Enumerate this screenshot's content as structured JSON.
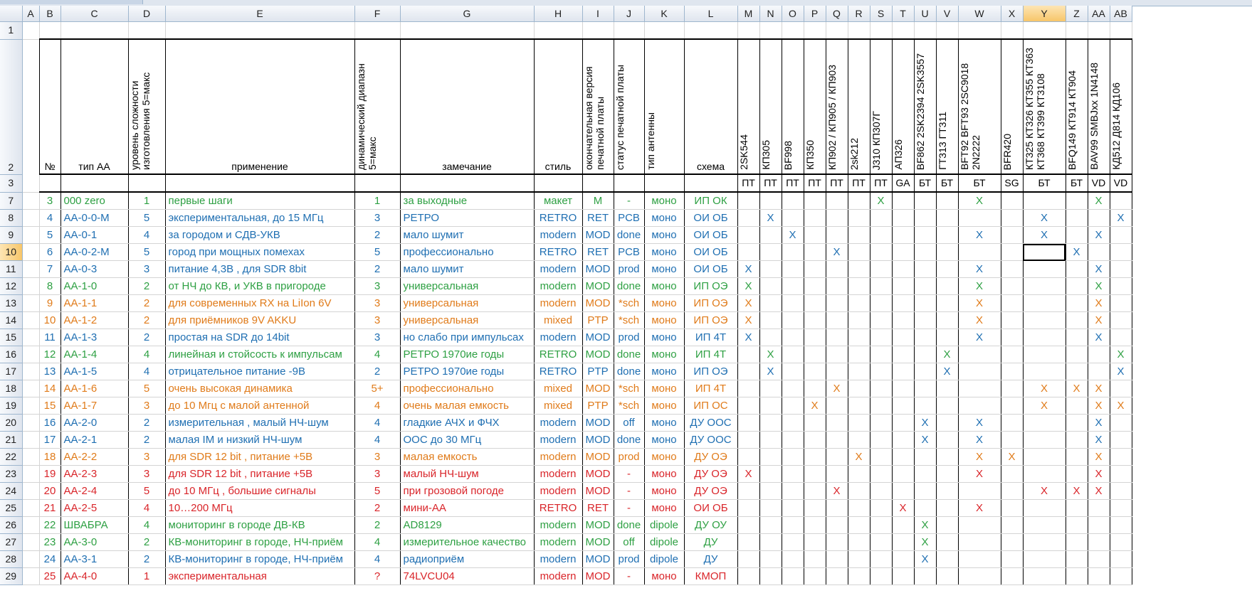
{
  "columns": [
    {
      "letter": "A",
      "w": 24
    },
    {
      "letter": "B",
      "w": 30
    },
    {
      "letter": "C",
      "w": 95
    },
    {
      "letter": "D",
      "w": 52
    },
    {
      "letter": "E",
      "w": 266
    },
    {
      "letter": "F",
      "w": 64
    },
    {
      "letter": "G",
      "w": 188
    },
    {
      "letter": "H",
      "w": 68
    },
    {
      "letter": "I",
      "w": 44
    },
    {
      "letter": "J",
      "w": 43
    },
    {
      "letter": "K",
      "w": 56
    },
    {
      "letter": "L",
      "w": 75
    },
    {
      "letter": "M",
      "w": 31
    },
    {
      "letter": "N",
      "w": 31
    },
    {
      "letter": "O",
      "w": 31
    },
    {
      "letter": "P",
      "w": 31
    },
    {
      "letter": "Q",
      "w": 31
    },
    {
      "letter": "R",
      "w": 31
    },
    {
      "letter": "S",
      "w": 31
    },
    {
      "letter": "T",
      "w": 31
    },
    {
      "letter": "U",
      "w": 31
    },
    {
      "letter": "V",
      "w": 31
    },
    {
      "letter": "W",
      "w": 60
    },
    {
      "letter": "X",
      "w": 31
    },
    {
      "letter": "Y",
      "w": 60
    },
    {
      "letter": "Z",
      "w": 31
    },
    {
      "letter": "AA",
      "w": 31
    },
    {
      "letter": "AB",
      "w": 31
    }
  ],
  "selected": {
    "col": "Y",
    "row": "10"
  },
  "row1": {
    "num": "1"
  },
  "row2": {
    "num": "2",
    "cells": [
      "",
      "№",
      "тип АА",
      "уровень сложности изготовления 5=макс",
      "применение",
      "динамический диапазн 5=макс",
      "замечание",
      "стиль",
      "окончательная версия печатной платы",
      "статус печатной платы",
      "тип антенны",
      "схема",
      "2SK544",
      "КП305",
      "BF998",
      "КП350",
      "КП902 / КП905 / КП903",
      "2sk212",
      "J310 КП307Г",
      "АП326",
      "BF862 2SK2394 2SK3557",
      "ГТ313 ГТ311",
      "BFT92 BFT93 2SC9018 2N2222",
      "BFR420",
      "КТ325 КТ326 КТ355 КТ363 КТ368 КТ399 КТ3108",
      "BFQ149 КТ914 КТ904",
      "BAV99 SMBJxx 1N4148",
      "КД512 Д814 КД106"
    ]
  },
  "row3": {
    "num": "3",
    "cells": [
      "",
      "",
      "",
      "",
      "",
      "",
      "",
      "",
      "",
      "",
      "",
      "",
      "ПТ",
      "ПТ",
      "ПТ",
      "ПТ",
      "ПТ",
      "ПТ",
      "ПТ",
      "GA",
      "БТ",
      "БТ",
      "БТ",
      "SG",
      "БТ",
      "БТ",
      "VD",
      "VD"
    ]
  },
  "rows": [
    {
      "num": "7",
      "color": "green",
      "cells": [
        "",
        "3",
        "000 zero",
        "1",
        "первые шаги",
        "1",
        "за выходные",
        "макет",
        "М",
        "-",
        "моно",
        "ИП ОК",
        "",
        "",
        "",
        "",
        "",
        "",
        "X",
        "",
        "",
        "",
        "X",
        "",
        "",
        "",
        "X",
        ""
      ]
    },
    {
      "num": "8",
      "color": "blue",
      "cells": [
        "",
        "4",
        "АА-0-0-М",
        "5",
        "экспериментальная, до 15 МГц",
        "3",
        "РЕТРО",
        "RETRO",
        "RET",
        "PCB",
        "моно",
        "ОИ ОБ",
        "",
        "X",
        "",
        "",
        "",
        "",
        "",
        "",
        "",
        "",
        "",
        "",
        "X",
        "",
        "",
        "X"
      ]
    },
    {
      "num": "9",
      "color": "blue",
      "cells": [
        "",
        "5",
        "АА-0-1",
        "4",
        "за городом и СДВ-УКВ",
        "2",
        "мало шумит",
        "modern",
        "MOD",
        "done",
        "моно",
        "ОИ ОБ",
        "",
        "",
        "X",
        "",
        "",
        "",
        "",
        "",
        "",
        "",
        "X",
        "",
        "X",
        "",
        "X",
        ""
      ]
    },
    {
      "num": "10",
      "color": "blue",
      "cells": [
        "",
        "6",
        "АА-0-2-М",
        "5",
        "город при мощных помехах",
        "5",
        "профессионально",
        "RETRO",
        "RET",
        "PCB",
        "моно",
        "ОИ ОБ",
        "",
        "",
        "",
        "",
        "X",
        "",
        "",
        "",
        "",
        "",
        "",
        "",
        "",
        "X",
        "",
        ""
      ]
    },
    {
      "num": "11",
      "color": "blue",
      "cells": [
        "",
        "7",
        "АА-0-3",
        "3",
        "питание 4,3В , для SDR 8bit",
        "2",
        "мало шумит",
        "modern",
        "MOD",
        "prod",
        "моно",
        "ОИ ОБ",
        "X",
        "",
        "",
        "",
        "",
        "",
        "",
        "",
        "",
        "",
        "X",
        "",
        "",
        "",
        "X",
        ""
      ]
    },
    {
      "num": "12",
      "color": "green",
      "cells": [
        "",
        "8",
        "АА-1-0",
        "2",
        "от НЧ до КВ, и УКВ в пригороде",
        "3",
        "универсальная",
        "modern",
        "MOD",
        "done",
        "моно",
        "ИП ОЭ",
        "X",
        "",
        "",
        "",
        "",
        "",
        "",
        "",
        "",
        "",
        "X",
        "",
        "",
        "",
        "X",
        ""
      ]
    },
    {
      "num": "13",
      "color": "orange",
      "cells": [
        "",
        "9",
        "АА-1-1",
        "2",
        "для современных RX на LiIon 6V",
        "3",
        "универсальная",
        "modern",
        "MOD",
        "*sch",
        "моно",
        "ИП ОЭ",
        "X",
        "",
        "",
        "",
        "",
        "",
        "",
        "",
        "",
        "",
        "X",
        "",
        "",
        "",
        "X",
        ""
      ]
    },
    {
      "num": "14",
      "color": "orange",
      "cells": [
        "",
        "10",
        "АА-1-2",
        "2",
        "для приёмников  9V AKKU",
        "3",
        "универсальная",
        "mixed",
        "PTP",
        "*sch",
        "моно",
        "ИП ОЭ",
        "X",
        "",
        "",
        "",
        "",
        "",
        "",
        "",
        "",
        "",
        "X",
        "",
        "",
        "",
        "X",
        ""
      ]
    },
    {
      "num": "15",
      "color": "blue",
      "cells": [
        "",
        "11",
        "АА-1-3",
        "2",
        "простая на SDR до  14bit",
        "3",
        "но слабо при импульсах",
        "modern",
        "MOD",
        "prod",
        "моно",
        "ИП 4Т",
        "X",
        "",
        "",
        "",
        "",
        "",
        "",
        "",
        "",
        "",
        "X",
        "",
        "",
        "",
        "X",
        ""
      ]
    },
    {
      "num": "16",
      "color": "green",
      "cells": [
        "",
        "12",
        "АА-1-4",
        "4",
        "линейная и  стойсость к импульсам",
        "4",
        "РЕТРО 1970ие годы",
        "RETRO",
        "MOD",
        "done",
        "моно",
        "ИП 4Т",
        "",
        "X",
        "",
        "",
        "",
        "",
        "",
        "",
        "",
        "X",
        "",
        "",
        "",
        "",
        "",
        "X"
      ]
    },
    {
      "num": "17",
      "color": "blue",
      "cells": [
        "",
        "13",
        "АА-1-5",
        "4",
        "отрицательное питание -9В",
        "2",
        "РЕТРО 1970ие годы",
        "RETRO",
        "PTP",
        "done",
        "моно",
        "ИП ОЭ",
        "",
        "X",
        "",
        "",
        "",
        "",
        "",
        "",
        "",
        "X",
        "",
        "",
        "",
        "",
        "",
        "X"
      ]
    },
    {
      "num": "18",
      "color": "orange",
      "cells": [
        "",
        "14",
        "АА-1-6",
        "5",
        "очень высокая динамика",
        "5+",
        "профессионально",
        "mixed",
        "MOD",
        "*sch",
        "моно",
        "ИП 4Т",
        "",
        "",
        "",
        "",
        "X",
        "",
        "",
        "",
        "",
        "",
        "",
        "",
        "X",
        "X",
        "X",
        ""
      ]
    },
    {
      "num": "19",
      "color": "orange",
      "cells": [
        "",
        "15",
        "АА-1-7",
        "3",
        "до 10 Мгц с малой антенной",
        "4",
        "очень малая емкость",
        "mixed",
        "PTP",
        "*sch",
        "моно",
        "ИП ОС",
        "",
        "",
        "",
        "X",
        "",
        "",
        "",
        "",
        "",
        "",
        "",
        "",
        "X",
        "",
        "X",
        "X"
      ]
    },
    {
      "num": "20",
      "color": "blue",
      "cells": [
        "",
        "16",
        "АА-2-0",
        "2",
        "измерительная , малый НЧ-шум",
        "4",
        "гладкие АЧХ и ФЧХ",
        "modern",
        "MOD",
        "off",
        "моно",
        "ДУ ООС",
        "",
        "",
        "",
        "",
        "",
        "",
        "",
        "",
        "X",
        "",
        "X",
        "",
        "",
        "",
        "X",
        ""
      ]
    },
    {
      "num": "21",
      "color": "blue",
      "cells": [
        "",
        "17",
        "АА-2-1",
        "2",
        "малая IM и низкий НЧ-шум",
        "4",
        "ООС до 30 МГц",
        "modern",
        "MOD",
        "done",
        "моно",
        "ДУ ООС",
        "",
        "",
        "",
        "",
        "",
        "",
        "",
        "",
        "X",
        "",
        "X",
        "",
        "",
        "",
        "X",
        ""
      ]
    },
    {
      "num": "22",
      "color": "orange",
      "cells": [
        "",
        "18",
        "АА-2-2",
        "3",
        "для SDR 12 bit , питание +5В",
        "3",
        "малая емкость",
        "modern",
        "MOD",
        "prod",
        "моно",
        "ДУ ОЭ",
        "",
        "",
        "",
        "",
        "",
        "X",
        "",
        "",
        "",
        "",
        "X",
        "X",
        "",
        "",
        "X",
        ""
      ]
    },
    {
      "num": "23",
      "color": "red",
      "cells": [
        "",
        "19",
        "АА-2-3",
        "3",
        "для SDR 12 bit , питание +5В",
        "3",
        "малый НЧ-шум",
        "modern",
        "MOD",
        "-",
        "моно",
        "ДУ ОЭ",
        "X",
        "",
        "",
        "",
        "",
        "",
        "",
        "",
        "",
        "",
        "X",
        "",
        "",
        "",
        "X",
        ""
      ]
    },
    {
      "num": "24",
      "color": "red",
      "cells": [
        "",
        "20",
        "АА-2-4",
        "5",
        "до 10 МГц , большие сигналы",
        "5",
        "при грозовой погоде",
        "modern",
        "MOD",
        "-",
        "моно",
        "ДУ ОЭ",
        "",
        "",
        "",
        "",
        "X",
        "",
        "",
        "",
        "",
        "",
        "",
        "",
        "X",
        "X",
        "X",
        ""
      ]
    },
    {
      "num": "25",
      "color": "red",
      "cells": [
        "",
        "21",
        "АА-2-5",
        "4",
        "10…200 МГц",
        "2",
        "мини-АА",
        "RETRO",
        "RET",
        "-",
        "моно",
        "ОИ ОБ",
        "",
        "",
        "",
        "",
        "",
        "",
        "",
        "X",
        "",
        "",
        "X",
        "",
        "",
        "",
        "",
        ""
      ]
    },
    {
      "num": "26",
      "color": "green",
      "cells": [
        "",
        "22",
        "ШВАБРА",
        "4",
        "мониторинг в городе ДВ-КВ",
        "2",
        "AD8129",
        "modern",
        "MOD",
        "done",
        "dipole",
        "ДУ ОУ",
        "",
        "",
        "",
        "",
        "",
        "",
        "",
        "",
        "X",
        "",
        "",
        "",
        "",
        "",
        "",
        ""
      ]
    },
    {
      "num": "27",
      "color": "green",
      "cells": [
        "",
        "23",
        "АА-3-0",
        "2",
        "КВ-мониторинг в городе, НЧ-приём",
        "4",
        "измерительное качество",
        "modern",
        "MOD",
        "off",
        "dipole",
        "ДУ",
        "",
        "",
        "",
        "",
        "",
        "",
        "",
        "",
        "X",
        "",
        "",
        "",
        "",
        "",
        "",
        ""
      ]
    },
    {
      "num": "28",
      "color": "blue",
      "cells": [
        "",
        "24",
        "АА-3-1",
        "2",
        "КВ-мониторинг в городе, НЧ-приём",
        "4",
        "радиоприём",
        "modern",
        "MOD",
        "prod",
        "dipole",
        "ДУ",
        "",
        "",
        "",
        "",
        "",
        "",
        "",
        "",
        "X",
        "",
        "",
        "",
        "",
        "",
        "",
        ""
      ]
    },
    {
      "num": "29",
      "color": "red",
      "cells": [
        "",
        "25",
        "АА-4-0",
        "1",
        "экспериментальная",
        "?",
        "74LVCU04",
        "modern",
        "MOD",
        "-",
        "моно",
        "КМОП",
        "",
        "",
        "",
        "",
        "",
        "",
        "",
        "",
        "",
        "",
        "",
        "",
        "",
        "",
        "",
        ""
      ]
    }
  ]
}
